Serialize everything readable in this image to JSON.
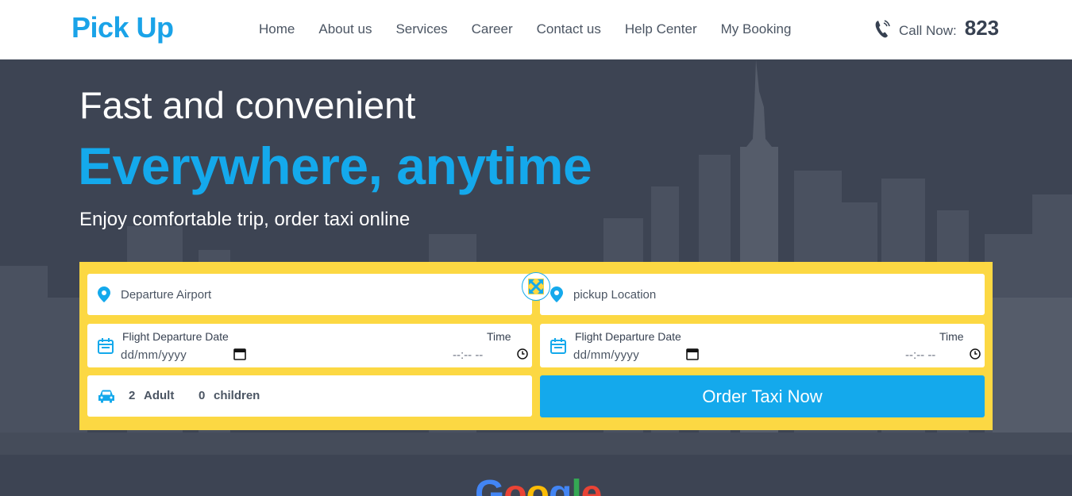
{
  "header": {
    "logo": "Pick Up",
    "nav": [
      "Home",
      "About us",
      "Services",
      "Career",
      "Contact us",
      "Help Center",
      "My Booking"
    ],
    "call_label": "Call Now:",
    "call_number": "823"
  },
  "hero": {
    "subtitle": "Fast and convenient",
    "headline": "Everywhere, anytime",
    "tagline": "Enjoy comfortable trip, order taxi online"
  },
  "booking": {
    "departure_placeholder": "Departure Airport",
    "pickup_placeholder": "pickup Location",
    "date_label": "Flight Departure Date",
    "date_placeholder": "dd/mm/yyyy",
    "time_label": "Time",
    "time_placeholder": "--:-- --",
    "adults_count": "2",
    "adults_label": "Adult",
    "children_count": "0",
    "children_label": "children",
    "order_button": "Order Taxi Now"
  },
  "partner_logo_text": "Google",
  "colors": {
    "brand_blue": "#14a9ec",
    "panel_yellow": "#fcd843",
    "hero_bg": "#3d4453"
  },
  "icons": [
    "phone-icon",
    "map-pin-icon",
    "calendar-icon",
    "clock-icon",
    "car-icon",
    "swap-icon"
  ]
}
